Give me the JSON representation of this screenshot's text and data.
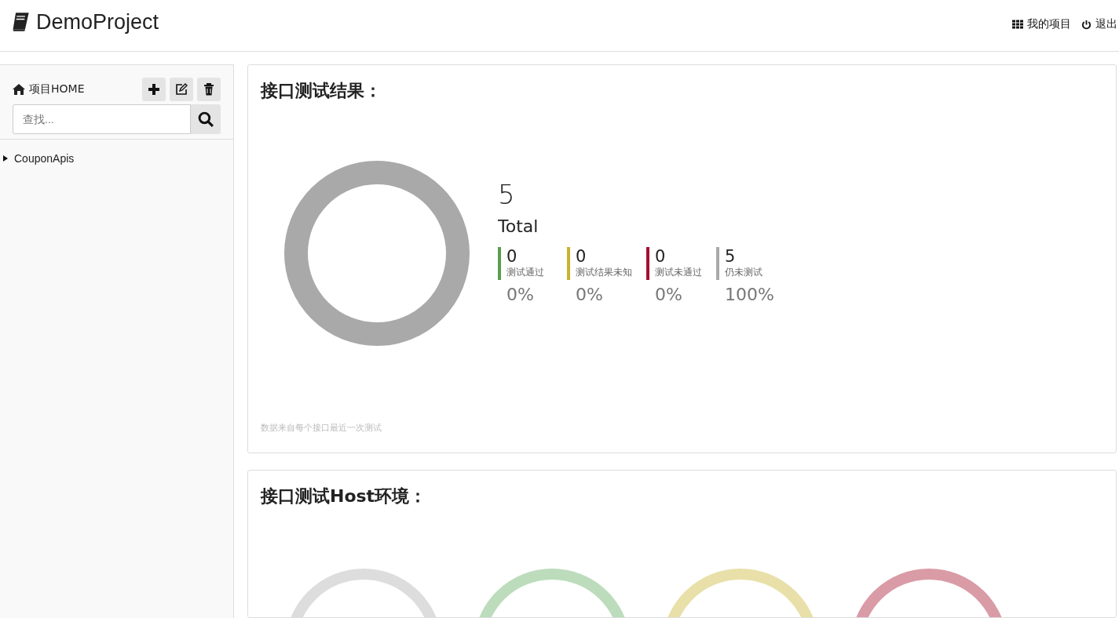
{
  "header": {
    "title": "DemoProject",
    "links": [
      {
        "label": "我的项目"
      },
      {
        "label": "退出"
      }
    ]
  },
  "sidebar": {
    "home_label": "项目HOME",
    "search": {
      "placeholder": "查找..."
    },
    "tree": [
      {
        "label": "CouponApis",
        "expanded": false
      }
    ]
  },
  "results_panel": {
    "title": "接口测试结果：",
    "total": "5",
    "total_label": "Total",
    "stats": [
      {
        "count": "0",
        "label": "测试通过",
        "percent": "0%",
        "color": "#5a9e4b"
      },
      {
        "count": "0",
        "label": "测试结果未知",
        "percent": "0%",
        "color": "#c9b22f"
      },
      {
        "count": "0",
        "label": "测试未通过",
        "percent": "0%",
        "color": "#a50f2d"
      },
      {
        "count": "5",
        "label": "仍未测试",
        "percent": "100%",
        "color": "#a9a9a9"
      }
    ],
    "note": "数据来自每个接口最近一次测试"
  },
  "host_panel": {
    "title": "接口测试Host环境：",
    "rings": [
      {
        "color": "#dddddd"
      },
      {
        "color": "#bcdcbb"
      },
      {
        "color": "#e8e0a8"
      },
      {
        "color": "#d99ba6"
      }
    ]
  }
}
